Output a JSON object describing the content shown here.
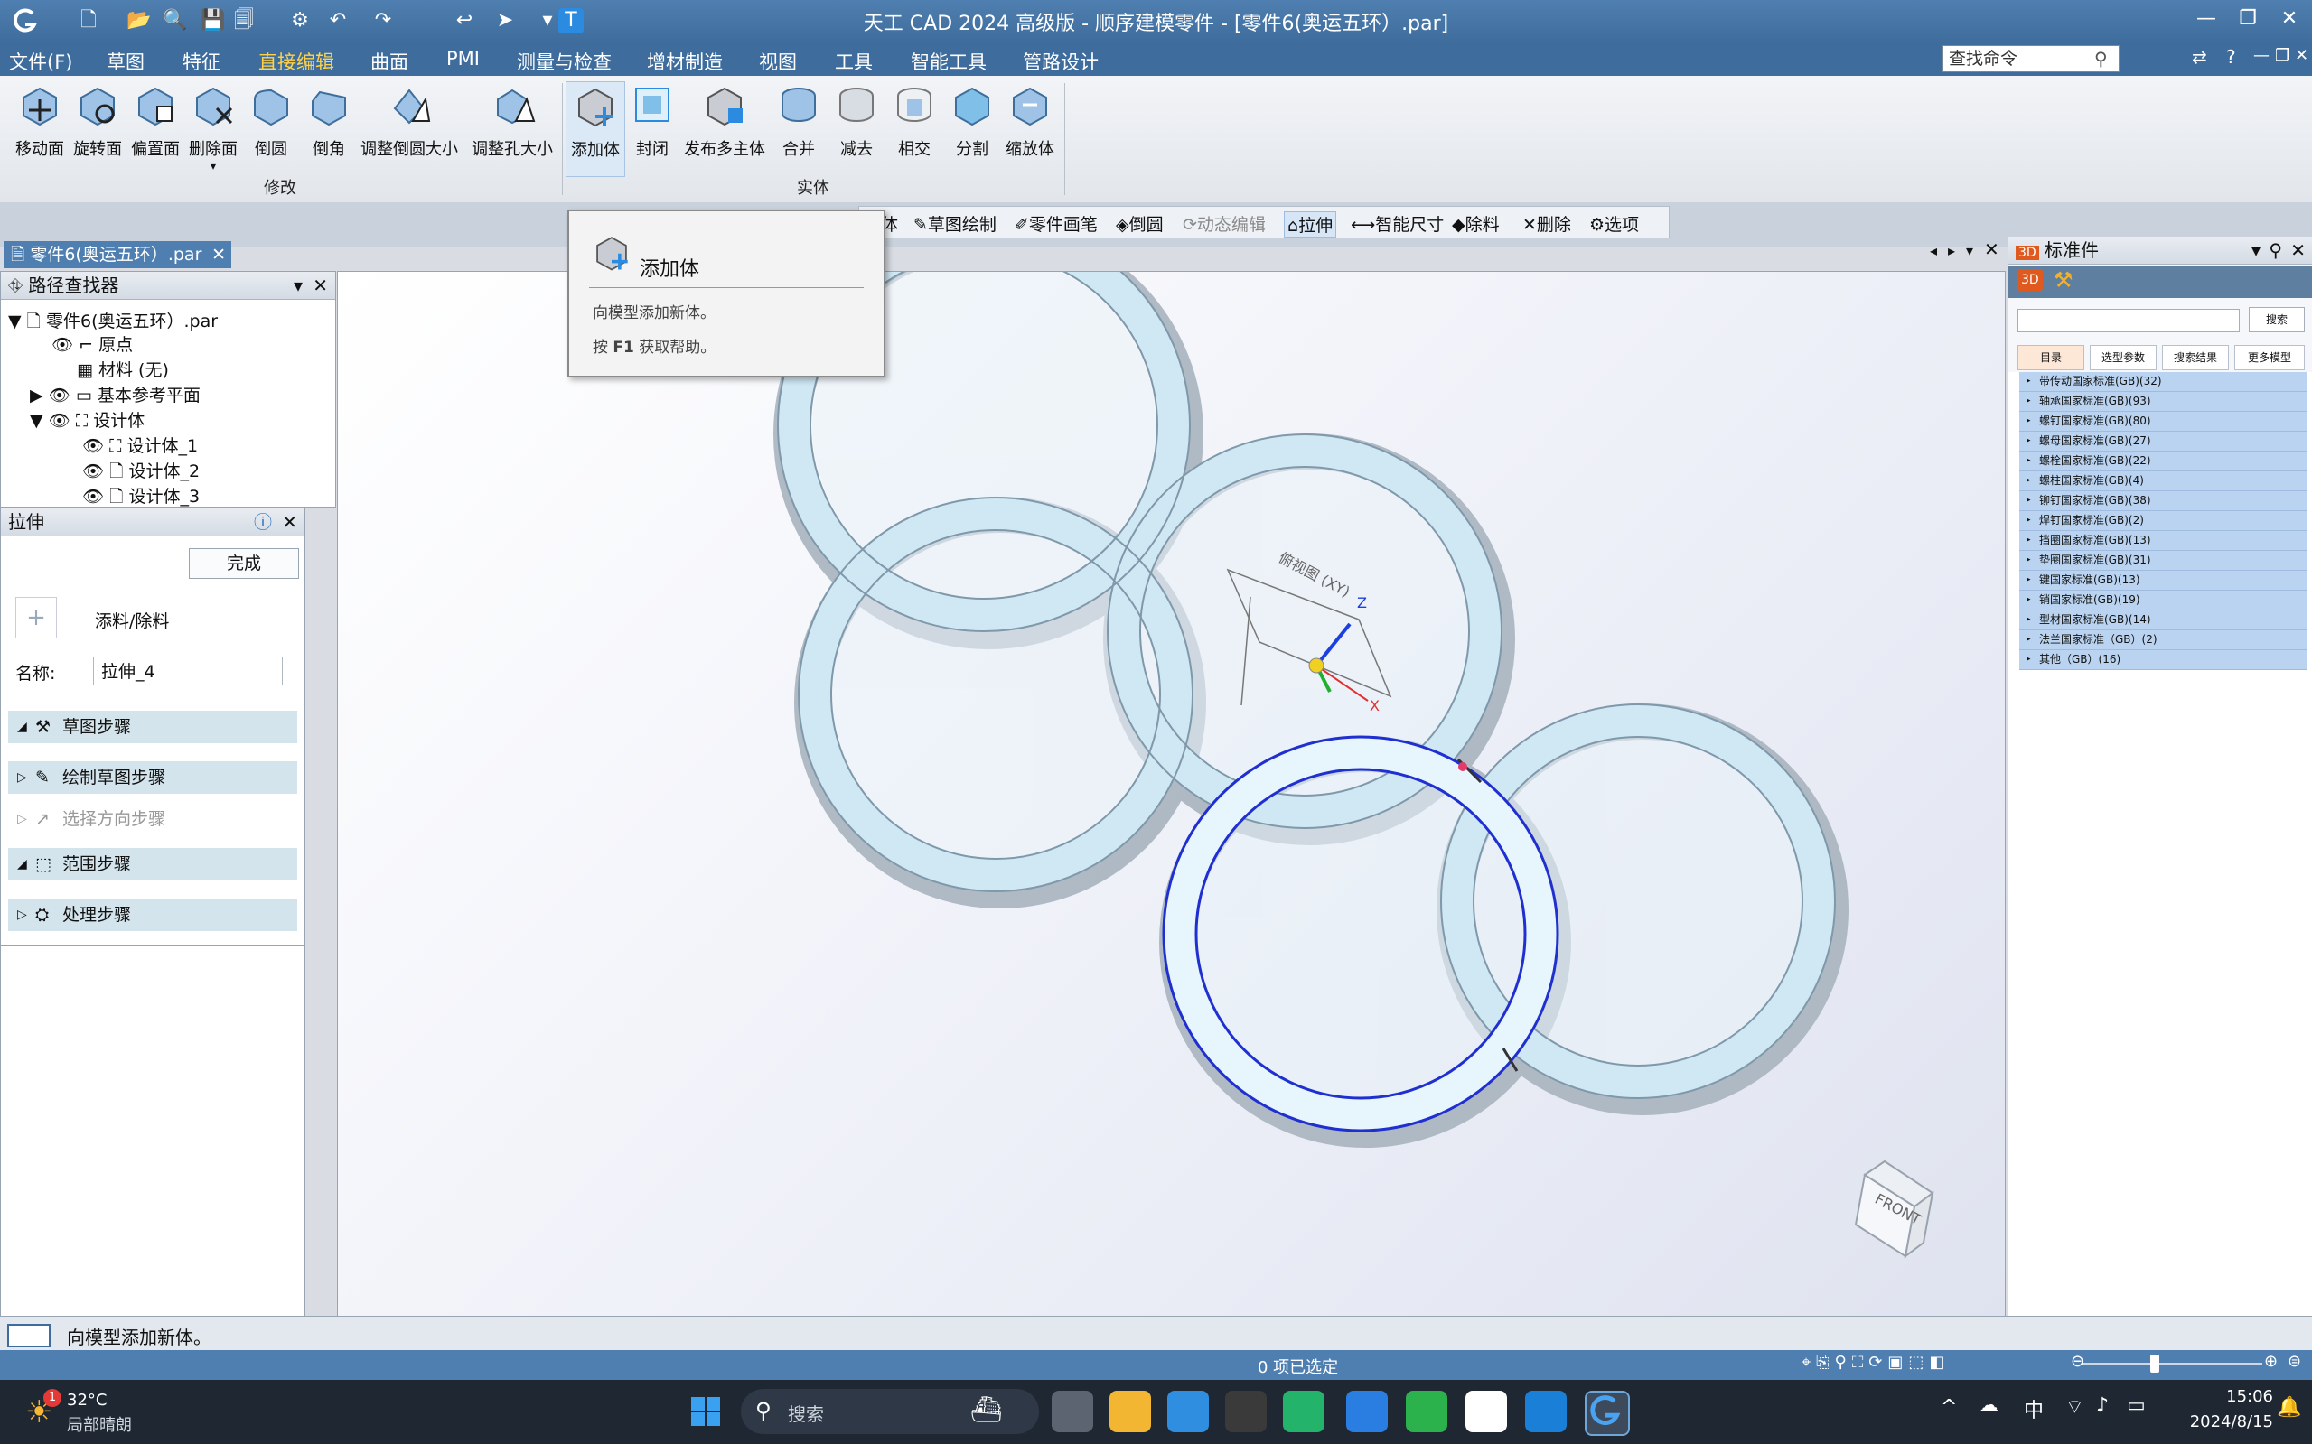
{
  "app": {
    "title": "天工 CAD 2024 高级版 - 顺序建模零件 - [零件6(奥运五环）.par]",
    "accent": "#3e6d9d"
  },
  "menu": {
    "items": [
      "文件(F)",
      "草图",
      "特征",
      "直接编辑",
      "曲面",
      "PMI",
      "测量与检查",
      "增材制造",
      "视图",
      "工具",
      "智能工具",
      "管路设计"
    ],
    "active": "直接编辑",
    "search_placeholder": "查找命令"
  },
  "ribbon": {
    "modify": {
      "label": "修改",
      "buttons": [
        "移动面",
        "旋转面",
        "偏置面",
        "删除面",
        "倒圆",
        "倒角",
        "调整倒圆大小",
        "调整孔大小"
      ]
    },
    "solid": {
      "label": "实体",
      "buttons": [
        "添加体",
        "封闭",
        "发布多主体",
        "合并",
        "减去",
        "相交",
        "分割",
        "缩放体"
      ]
    }
  },
  "doc_tab": "零件6(奥运五环）.par",
  "float_toolbar": [
    "体",
    "草图绘制",
    "零件画笔",
    "倒圆",
    "动态编辑",
    "拉伸",
    "智能尺寸",
    "除料",
    "删除",
    "选项"
  ],
  "tooltip": {
    "title": "添加体",
    "desc": "向模型添加新体。",
    "help_prefix": "按",
    "help_key": "F1",
    "help_suffix": "获取帮助。"
  },
  "pathfinder": {
    "title": "路径查找器",
    "rows": [
      "零件6(奥运五环）.par",
      "原点",
      "材料 (无)",
      "基本参考平面",
      "设计体",
      "设计体_1",
      "设计体_2",
      "设计体_3"
    ]
  },
  "extrude_panel": {
    "title": "拉伸",
    "finish": "完成",
    "add_remove": "添料/除料",
    "name_label": "名称:",
    "name_value": "拉伸_4",
    "steps": [
      "草图步骤",
      "绘制草图步骤",
      "选择方向步骤",
      "范围步骤",
      "处理步骤"
    ]
  },
  "viewport": {
    "view_label": "俯视图 (XY)",
    "cube_label": "FRONT",
    "axis_z": "Z",
    "axis_x": "X"
  },
  "right_panel": {
    "title": "标准件",
    "search_button": "搜索",
    "tabs": [
      "目录",
      "选型参数",
      "搜索结果",
      "更多模型"
    ],
    "items": [
      "带传动国家标准(GB)(32)",
      "轴承国家标准(GB)(93)",
      "螺钉国家标准(GB)(80)",
      "螺母国家标准(GB)(27)",
      "螺栓国家标准(GB)(22)",
      "螺柱国家标准(GB)(4)",
      "铆钉国家标准(GB)(38)",
      "焊钉国家标准(GB)(2)",
      "挡圈国家标准(GB)(13)",
      "垫圈国家标准(GB)(31)",
      "键国家标准(GB)(13)",
      "销国家标准(GB)(19)",
      "型材国家标准(GB)(14)",
      "法兰国家标准（GB）(2)",
      "其他（GB）(16)"
    ]
  },
  "status": {
    "message": "向模型添加新体。",
    "selection": "0 项已选定"
  },
  "taskbar": {
    "weather_temp": "32°C",
    "weather_desc": "局部晴朗",
    "badge": "1",
    "search": "搜索",
    "ime": "中",
    "time": "15:06",
    "date": "2024/8/15"
  }
}
